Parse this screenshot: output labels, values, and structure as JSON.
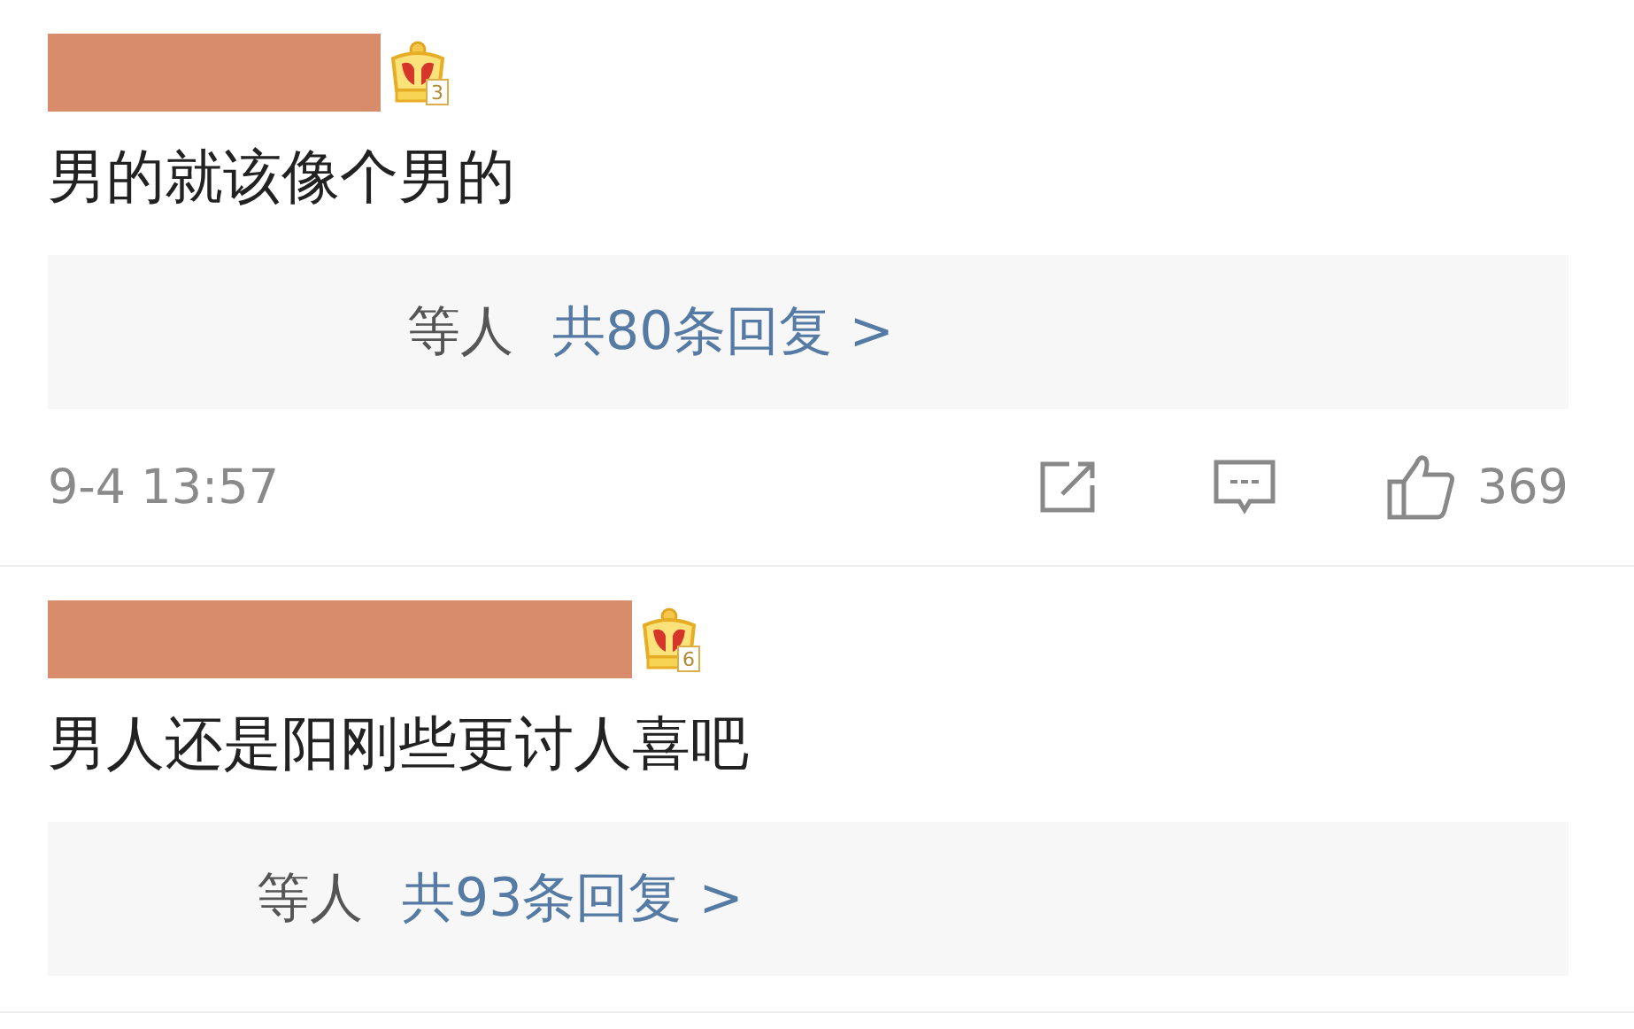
{
  "comments": [
    {
      "name_redacted": true,
      "badge_level": "3",
      "text": "男的就该像个男的",
      "replies": {
        "prefix": "等人",
        "link": "共80条回复 >"
      },
      "time": "9-4 13:57",
      "likes": "369"
    },
    {
      "name_redacted": true,
      "badge_level": "6",
      "text": "男人还是阳刚些更讨人喜吧",
      "replies": {
        "prefix": "等人",
        "link": "共93条回复 >"
      }
    }
  ]
}
